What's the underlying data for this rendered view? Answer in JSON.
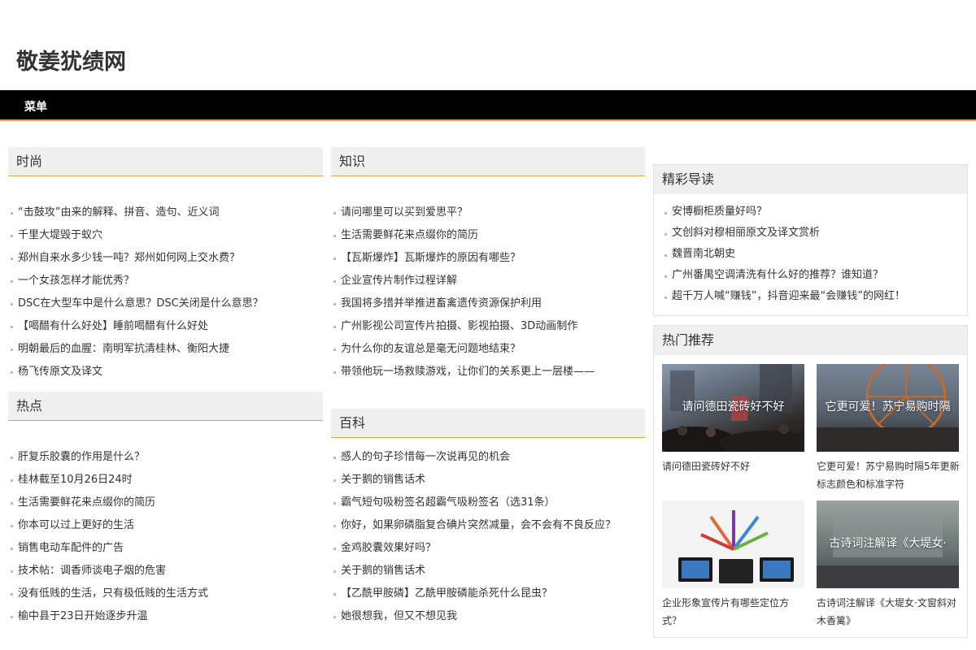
{
  "site": {
    "title": "敬姜犹绩网"
  },
  "nav": {
    "menu_label": "菜单"
  },
  "sections": {
    "fashion": {
      "title": "时尚",
      "items": [
        "“击鼓攻”由来的解释、拼音、造句、近义词",
        "千里大堤毁于蚁穴",
        "郑州自来水多少钱一吨？郑州如何网上交水费？",
        "一个女孩怎样才能优秀？",
        "DSC在大型车中是什么意思？DSC关闭是什么意思？",
        "【喝醋有什么好处】睡前喝醋有什么好处",
        "明朝最后的血腥：南明军抗清桂林、衡阳大捷",
        "杨飞传原文及译文"
      ]
    },
    "hot": {
      "title": "热点",
      "items": [
        "肝复乐胶囊的作用是什么？",
        "桂林截至10月26日24时",
        "生活需要鲜花来点缀你的简历",
        "你本可以过上更好的生活",
        "销售电动车配件的广告",
        "技术帖：调香师谈电子烟的危害",
        "没有低贱的生活，只有极低贱的生活方式",
        "榆中县于23日开始逐步升温"
      ]
    },
    "knowledge": {
      "title": "知识",
      "items": [
        "请问哪里可以买到爱思平？",
        "生活需要鲜花来点缀你的简历",
        "【瓦斯爆炸】瓦斯爆炸的原因有哪些？",
        "企业宣传片制作过程详解",
        "我国将多措并举推进畜禽遗传资源保护利用",
        "广州影视公司宣传片拍摄、影视拍摄、3D动画制作",
        "为什么你的友谊总是毫无问题地结束？",
        "带领他玩一场救赎游戏，让你们的关系更上一层楼——"
      ]
    },
    "encyclopedia": {
      "title": "百科",
      "items": [
        "感人的句子珍惜每一次说再见的机会",
        "关于鹅的销售话术",
        "霸气短句吸粉签名超霸气吸粉签名（选31条）",
        "你好，如果卵磷脂复合碘片突然减量，会不会有不良反应？",
        "金鸡胶囊效果好吗？",
        "关于鹅的销售话术",
        "【乙酰甲胺磷】乙酰甲胺磷能杀死什么昆虫？",
        "她很想我，但又不想见我"
      ]
    }
  },
  "featured": {
    "title": "精彩导读",
    "items": [
      "安博橱柜质量好吗？",
      "文创斜对穆相丽原文及译文赏析",
      "魏晋南北朝史",
      "广州番禺空调清洗有什么好的推荐？谁知道？",
      "超千万人喊“赚钱”，抖音迎来最“会赚钱”的网红！"
    ]
  },
  "recommend": {
    "title": "热门推荐",
    "cards": [
      {
        "caption": "请问德田瓷砖好不好",
        "title": "请问德田瓷砖好不好"
      },
      {
        "caption": "它更可爱！苏宁易购时隔",
        "title": "它更可爱！苏宁易购时隔5年更新标志颜色和标准字符"
      },
      {
        "caption": "",
        "title": "企业形象宣传片有哪些定位方式？"
      },
      {
        "caption": "古诗词注解译《大堤女·",
        "title": "古诗词注解译《大堤女·文窗斜对木香篱》"
      }
    ]
  }
}
